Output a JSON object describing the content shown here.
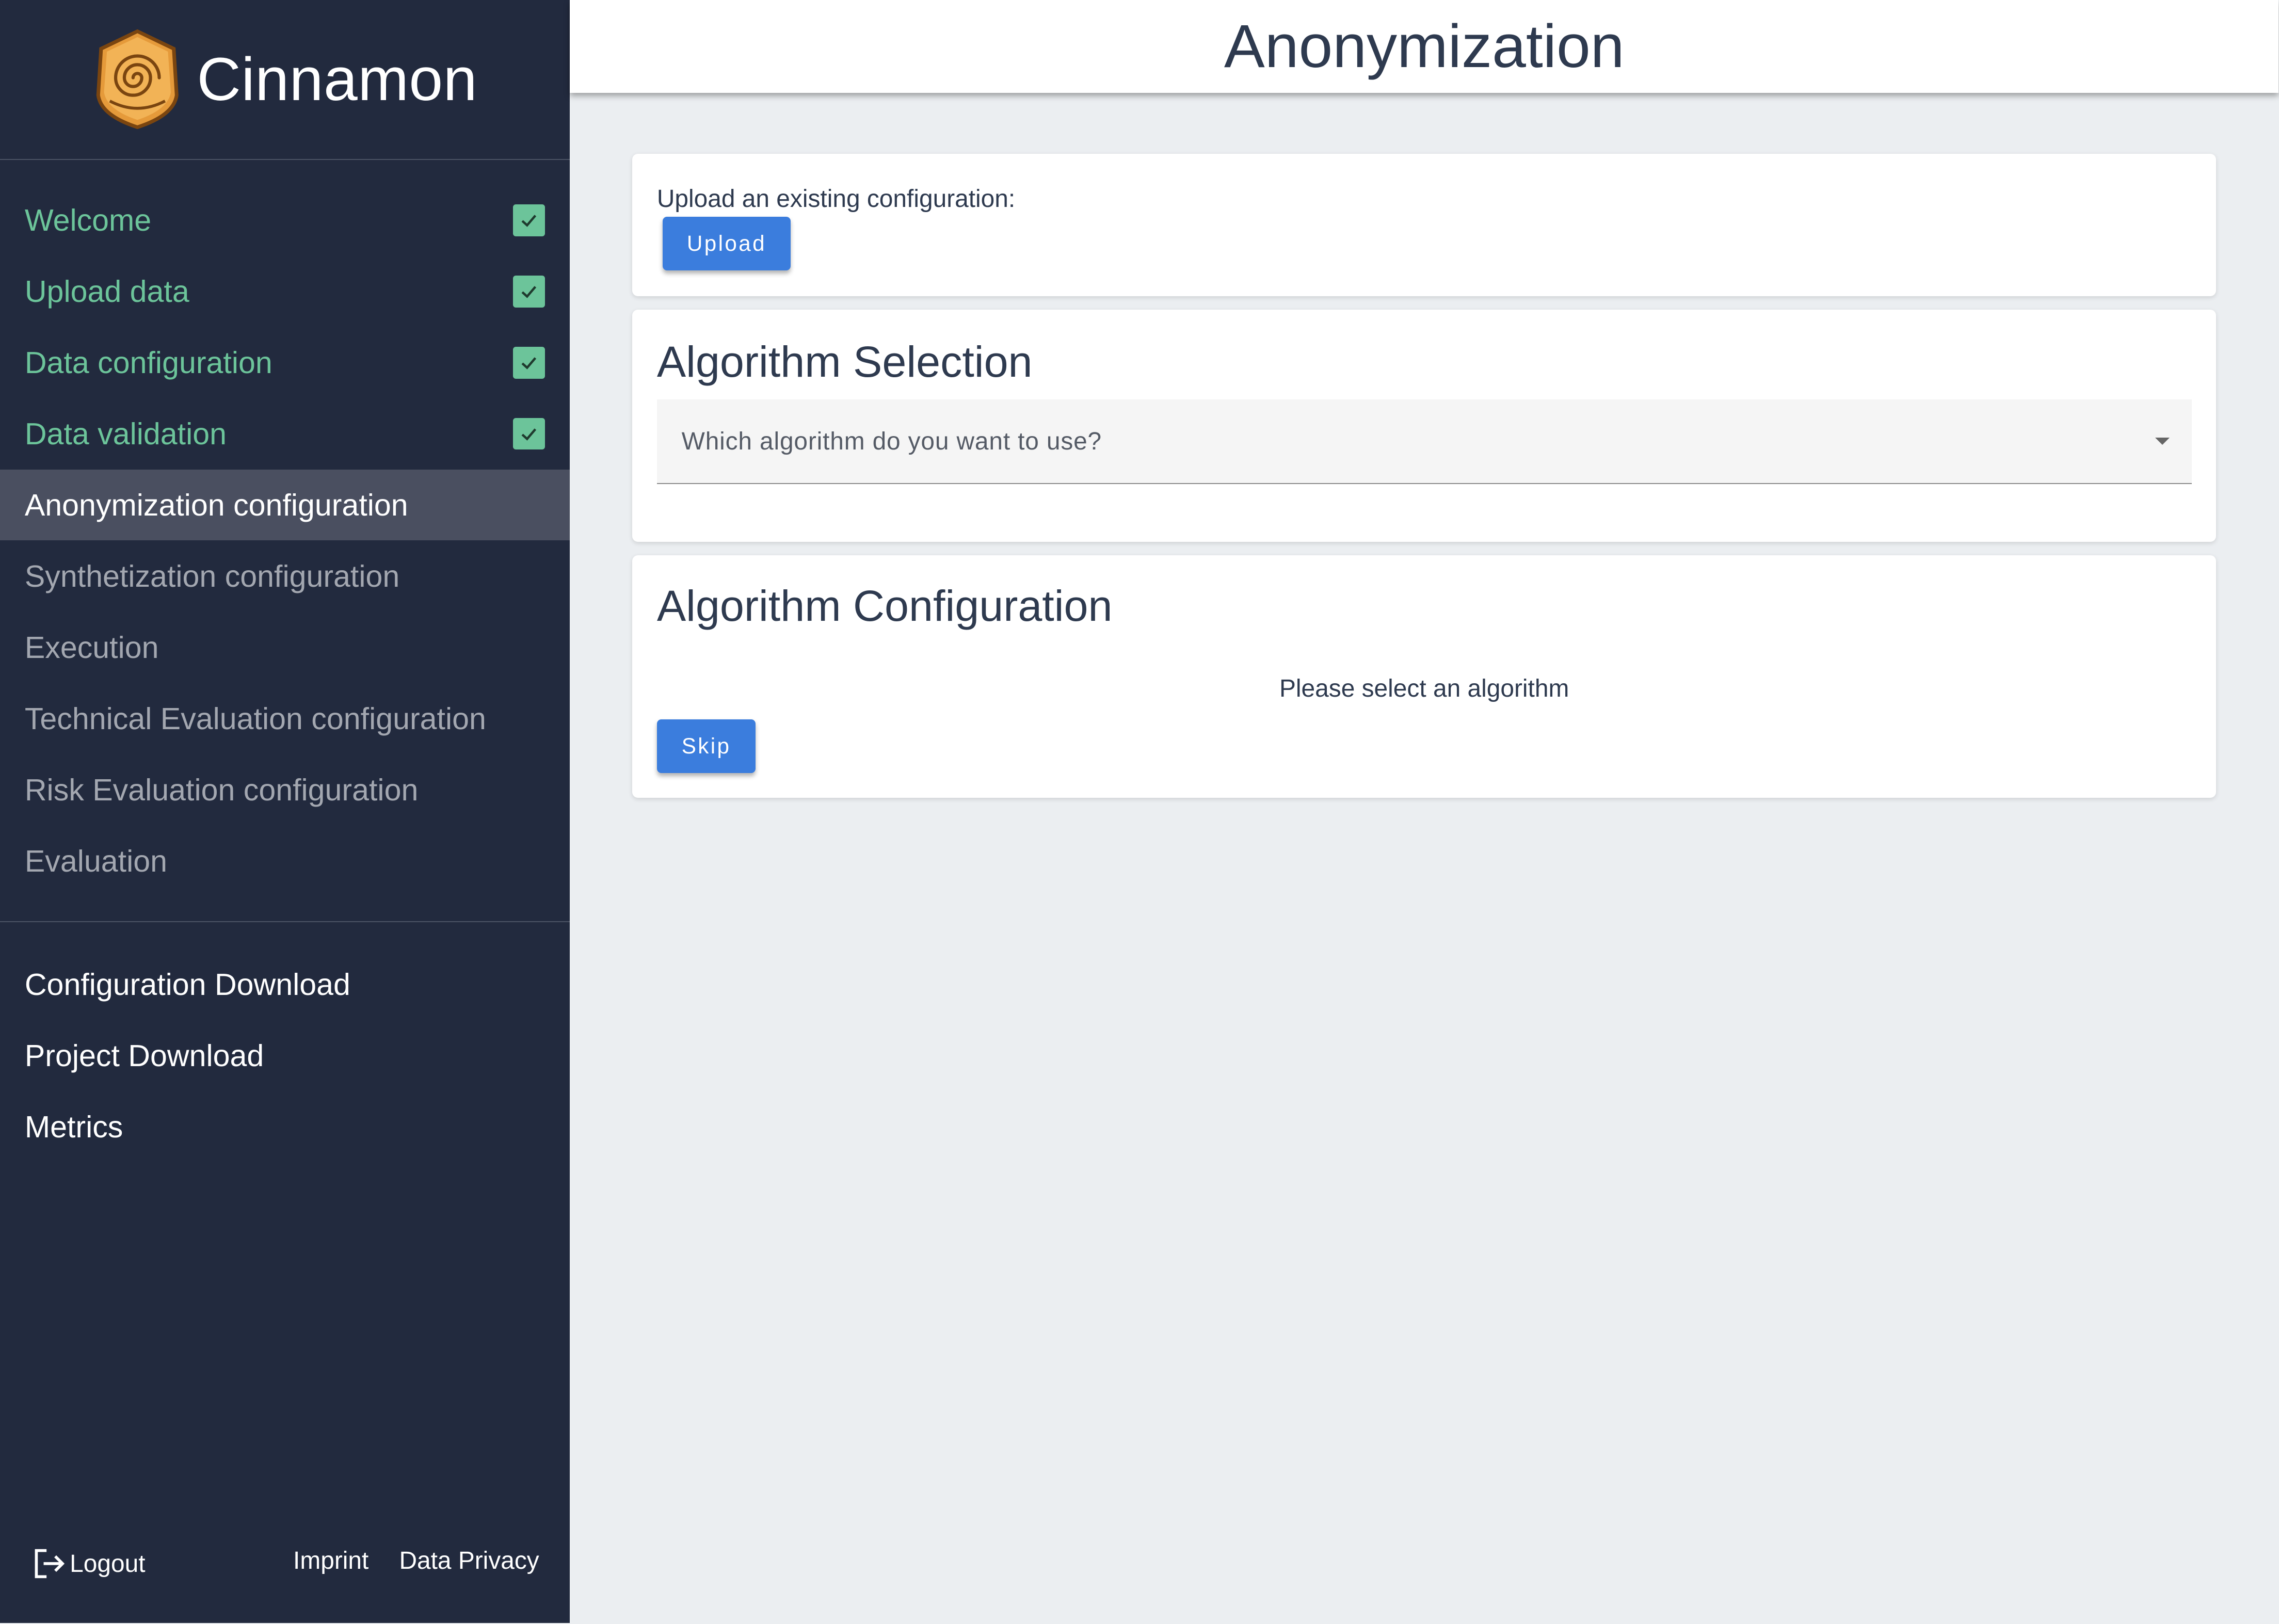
{
  "app": {
    "name": "Cinnamon",
    "logo_icon": "cinnamon-roll-icon"
  },
  "page": {
    "title": "Anonymization"
  },
  "sidebar": {
    "steps": [
      {
        "label": "Welcome",
        "status": "done"
      },
      {
        "label": "Upload data",
        "status": "done"
      },
      {
        "label": "Data configuration",
        "status": "done"
      },
      {
        "label": "Data validation",
        "status": "done"
      },
      {
        "label": "Anonymization configuration",
        "status": "active"
      },
      {
        "label": "Synthetization configuration",
        "status": "pending"
      },
      {
        "label": "Execution",
        "status": "pending"
      },
      {
        "label": "Technical Evaluation configuration",
        "status": "pending"
      },
      {
        "label": "Risk Evaluation configuration",
        "status": "pending"
      },
      {
        "label": "Evaluation",
        "status": "pending"
      }
    ],
    "tools": [
      {
        "label": "Configuration Download"
      },
      {
        "label": "Project Download"
      },
      {
        "label": "Metrics"
      }
    ],
    "footer": {
      "logout": "Logout",
      "imprint": "Imprint",
      "privacy": "Data Privacy"
    }
  },
  "upload_card": {
    "label": "Upload an existing configuration:",
    "button": "Upload"
  },
  "algorithm_selection": {
    "title": "Algorithm Selection",
    "placeholder": "Which algorithm do you want to use?"
  },
  "algorithm_configuration": {
    "title": "Algorithm Configuration",
    "message": "Please select an algorithm",
    "skip_button": "Skip"
  },
  "colors": {
    "sidebar_bg": "#222a3e",
    "done_green": "#6cc49a",
    "active_bg": "#4a4f60",
    "pending_text": "#a3a7b0",
    "primary_button": "#3b7ddd",
    "content_bg": "#ebeef1",
    "heading_text": "#2e3a4f"
  }
}
